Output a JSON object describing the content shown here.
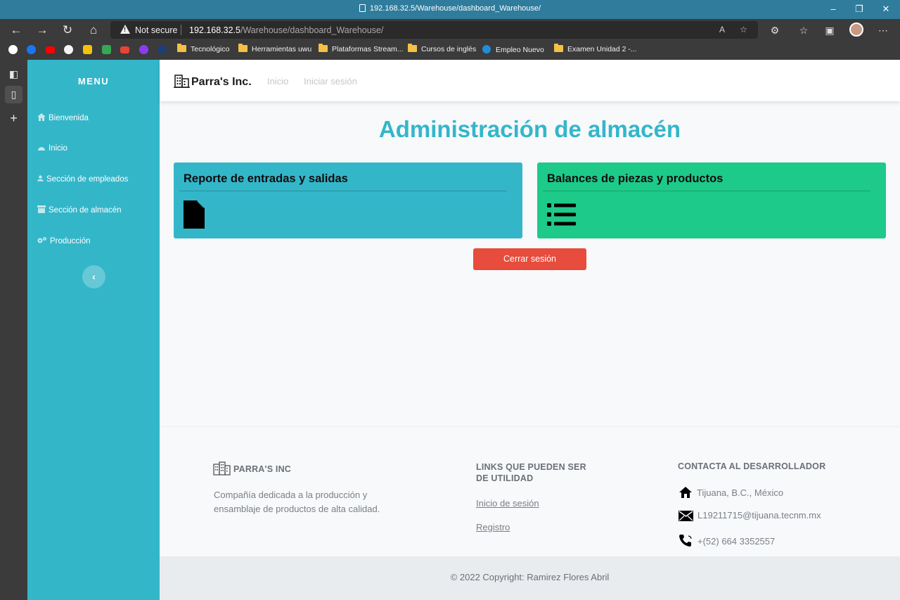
{
  "browser": {
    "tab_title": "192.168.32.5/Warehouse/dashboard_Warehouse/",
    "security_label": "Not secure",
    "url_host": "192.168.32.5",
    "url_path": "/Warehouse/dashboard_Warehouse/",
    "bookmarks": [
      {
        "label": "Tecnológico",
        "icon": "folder-icon"
      },
      {
        "label": "Herramientas uwu",
        "icon": "folder-icon"
      },
      {
        "label": "Plataformas Stream...",
        "icon": "folder-icon"
      },
      {
        "label": "Cursos de inglés",
        "icon": "folder-icon"
      },
      {
        "label": "Empleo Nuevo",
        "icon": "edge-icon"
      },
      {
        "label": "Examen Unidad 2 -...",
        "icon": "folder-icon"
      }
    ]
  },
  "sidebar": {
    "title": "MENU",
    "items": [
      {
        "label": "Bienvenida",
        "icon": "home-icon"
      },
      {
        "label": "Inicio",
        "icon": "dashboard-icon"
      },
      {
        "label": "Sección de empleados",
        "icon": "user-icon"
      },
      {
        "label": "Sección de almacén",
        "icon": "warehouse-icon"
      },
      {
        "label": "Producción",
        "icon": "gears-icon"
      }
    ],
    "collapse_glyph": "‹"
  },
  "navbar": {
    "brand": "Parra's Inc.",
    "links": [
      "Inicio",
      "Iniciar sesión"
    ]
  },
  "main": {
    "title": "Administración de almacén",
    "cards": [
      {
        "title": "Reporte de entradas y salidas",
        "icon": "file-icon",
        "color": "#34b6c9"
      },
      {
        "title": "Balances de piezas y productos",
        "icon": "list-icon",
        "color": "#1dca8a"
      }
    ],
    "logout_label": "Cerrar sesión",
    "logout_color": "#e74c3c"
  },
  "footer": {
    "company_heading": "PARRA'S INC",
    "company_description": "Compañía dedicada a la producción y ensamblaje de productos de alta calidad.",
    "links_heading": "LINKS QUE PUEDEN SER DE UTILIDAD",
    "links": [
      "Inicio de sesión",
      "Registro"
    ],
    "contact_heading": "CONTACTA AL DESARROLLADOR",
    "contacts": [
      {
        "text": "Tijuana, B.C., México",
        "icon": "house-icon"
      },
      {
        "text": "L19211715@tijuana.tecnm.mx",
        "icon": "envelope-icon"
      },
      {
        "text": "+(52) 664 3352557",
        "icon": "phone-icon"
      }
    ],
    "copyright": "© 2022 Copyright: Ramirez Flores Abril"
  }
}
